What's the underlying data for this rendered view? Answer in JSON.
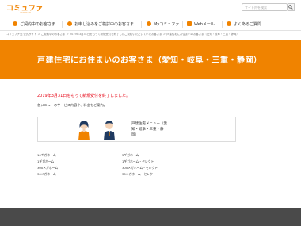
{
  "header": {
    "logo_main": "コミュファ",
    "logo_sub": "commufa",
    "search_placeholder": "サイト内を検索"
  },
  "nav": {
    "items": [
      {
        "label": "ご契約中のお客さま"
      },
      {
        "label": "お申し込みをご検討中のお客さま"
      },
      {
        "label": "Myコミュファ"
      },
      {
        "label": "Webメール"
      },
      {
        "label": "よくあるご質問"
      }
    ]
  },
  "breadcrumb": "コミュファ光 公式サイト ＞ ご契約中のお客さま ＞ 2019年3月31日をもって新規受付を終了したご契約いただいていたお客さま ＞ 戸建住宅にお住まいのお客さま（愛知・岐阜・三重・静岡）",
  "hero": {
    "title": "戸建住宅にお住まいのお客さま（愛知・岐阜・三重・静岡）"
  },
  "content": {
    "notice": "2019年3月31日をもって新規受付を終了しました。",
    "intro": "各メニューのサービス内容や、料金をご案内。",
    "card_text_line1": "戸建住宅メニュー（愛",
    "card_text_line2": "知・岐阜・三重・静",
    "card_text_line3": "岡）",
    "list_left": [
      "10ギガホーム",
      "1ギガホーム",
      "300メガホーム",
      "30メガホーム"
    ],
    "list_right": [
      "5ギガホーム",
      "1ギガホーム・セレクト",
      "300メガホーム・セレクト",
      "30メガホーム・セレクト"
    ]
  },
  "colors": {
    "brand": "#f08300",
    "notice": "#e60012",
    "footer": "#4a4a4a"
  }
}
